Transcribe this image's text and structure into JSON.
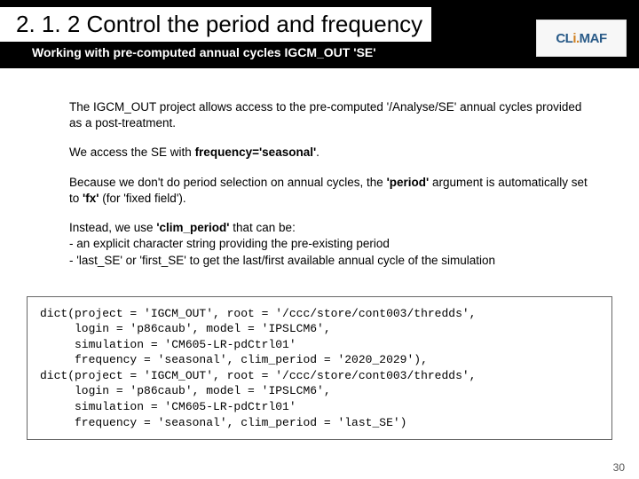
{
  "header": {
    "title": "2. 1. 2 Control the period and frequency",
    "subtitle": "Working with pre-computed annual cycles IGCM_OUT 'SE'"
  },
  "logo": {
    "text_pre": "CL",
    "text_i": "i.",
    "text_post": "MAF"
  },
  "body": {
    "p1": "The IGCM_OUT project allows access to the pre-computed '/Analyse/SE' annual cycles provided as a post-treatment.",
    "p2_a": "We access the SE with ",
    "p2_b": "frequency='seasonal'",
    "p2_c": ".",
    "p3_a": "Because we don't do period selection on annual cycles, the ",
    "p3_b": "'period'",
    "p3_c": " argument is automatically set to ",
    "p3_d": "'fx'",
    "p3_e": " (for 'fixed field').",
    "p4_a": "Instead, we use ",
    "p4_b": "'clim_period'",
    "p4_c": " that can be:",
    "p4_li1": "-   an explicit character string providing the pre-existing period",
    "p4_li2": "-   'last_SE' or 'first_SE' to get the last/first available annual cycle of the simulation"
  },
  "code": "dict(project = 'IGCM_OUT', root = '/ccc/store/cont003/thredds',\n     login = 'p86caub', model = 'IPSLCM6',\n     simulation = 'CM605-LR-pdCtrl01'\n     frequency = 'seasonal', clim_period = '2020_2029'),\ndict(project = 'IGCM_OUT', root = '/ccc/store/cont003/thredds',\n     login = 'p86caub', model = 'IPSLCM6',\n     simulation = 'CM605-LR-pdCtrl01'\n     frequency = 'seasonal', clim_period = 'last_SE')",
  "page_number": "30"
}
